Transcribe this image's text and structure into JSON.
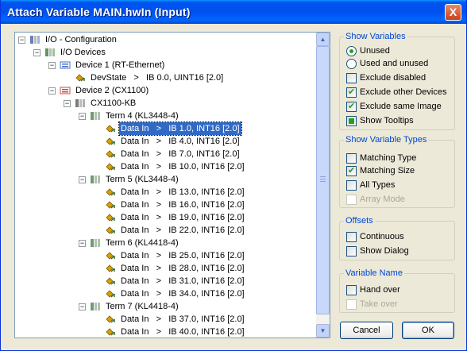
{
  "window": {
    "title": "Attach Variable MAIN.hwIn (Input)",
    "close_label": "X"
  },
  "tree": {
    "rows": [
      {
        "label": "I/O - Configuration",
        "icon": "io-config-icon"
      },
      {
        "label": "I/O Devices",
        "icon": "io-devices-icon"
      },
      {
        "label": "Device 1 (RT-Ethernet)",
        "icon": "ethernet-device-icon"
      },
      {
        "label": "DevState   >   IB 0.0, UINT16 [2.0]",
        "icon": "input-variable-icon"
      },
      {
        "label": "Device 2 (CX1100)",
        "icon": "cx-device-icon"
      },
      {
        "label": "CX1100-KB",
        "icon": "coupler-icon"
      },
      {
        "label": "Term 4 (KL3448-4)",
        "icon": "terminal-icon"
      },
      {
        "label": "Data In   >   IB 1.0, INT16 [2.0]",
        "icon": "input-variable-icon",
        "selected": true
      },
      {
        "label": "Data In   >   IB 4.0, INT16 [2.0]",
        "icon": "input-variable-icon"
      },
      {
        "label": "Data In   >   IB 7.0, INT16 [2.0]",
        "icon": "input-variable-icon"
      },
      {
        "label": "Data In   >   IB 10.0, INT16 [2.0]",
        "icon": "input-variable-icon"
      },
      {
        "label": "Term 5 (KL3448-4)",
        "icon": "terminal-icon"
      },
      {
        "label": "Data In   >   IB 13.0, INT16 [2.0]",
        "icon": "input-variable-icon"
      },
      {
        "label": "Data In   >   IB 16.0, INT16 [2.0]",
        "icon": "input-variable-icon"
      },
      {
        "label": "Data In   >   IB 19.0, INT16 [2.0]",
        "icon": "input-variable-icon"
      },
      {
        "label": "Data In   >   IB 22.0, INT16 [2.0]",
        "icon": "input-variable-icon"
      },
      {
        "label": "Term 6 (KL4418-4)",
        "icon": "terminal-icon"
      },
      {
        "label": "Data In   >   IB 25.0, INT16 [2.0]",
        "icon": "input-variable-icon"
      },
      {
        "label": "Data In   >   IB 28.0, INT16 [2.0]",
        "icon": "input-variable-icon"
      },
      {
        "label": "Data In   >   IB 31.0, INT16 [2.0]",
        "icon": "input-variable-icon"
      },
      {
        "label": "Data In   >   IB 34.0, INT16 [2.0]",
        "icon": "input-variable-icon"
      },
      {
        "label": "Term 7 (KL4418-4)",
        "icon": "terminal-icon"
      },
      {
        "label": "Data In   >   IB 37.0, INT16 [2.0]",
        "icon": "input-variable-icon"
      },
      {
        "label": "Data In   >   IB 40.0, INT16 [2.0]",
        "icon": "input-variable-icon"
      }
    ]
  },
  "show_variables": {
    "title": "Show Variables",
    "unused": "Unused",
    "used_and_unused": "Used and unused",
    "exclude_disabled": "Exclude disabled",
    "exclude_other_devices": "Exclude other Devices",
    "exclude_same_image": "Exclude same Image",
    "show_tooltips": "Show Tooltips"
  },
  "show_variable_types": {
    "title": "Show Variable Types",
    "matching_type": "Matching Type",
    "matching_size": "Matching Size",
    "all_types": "All Types",
    "array_mode": "Array Mode"
  },
  "offsets": {
    "title": "Offsets",
    "continuous": "Continuous",
    "show_dialog": "Show Dialog"
  },
  "variable_name": {
    "title": "Variable Name",
    "hand_over": "Hand over",
    "take_over": "Take over"
  },
  "buttons": {
    "cancel": "Cancel",
    "ok": "OK"
  },
  "colors": {
    "title_bar": "#0054e3",
    "selection": "#316ac5",
    "group_title": "#0046d5",
    "check": "#21a121"
  }
}
